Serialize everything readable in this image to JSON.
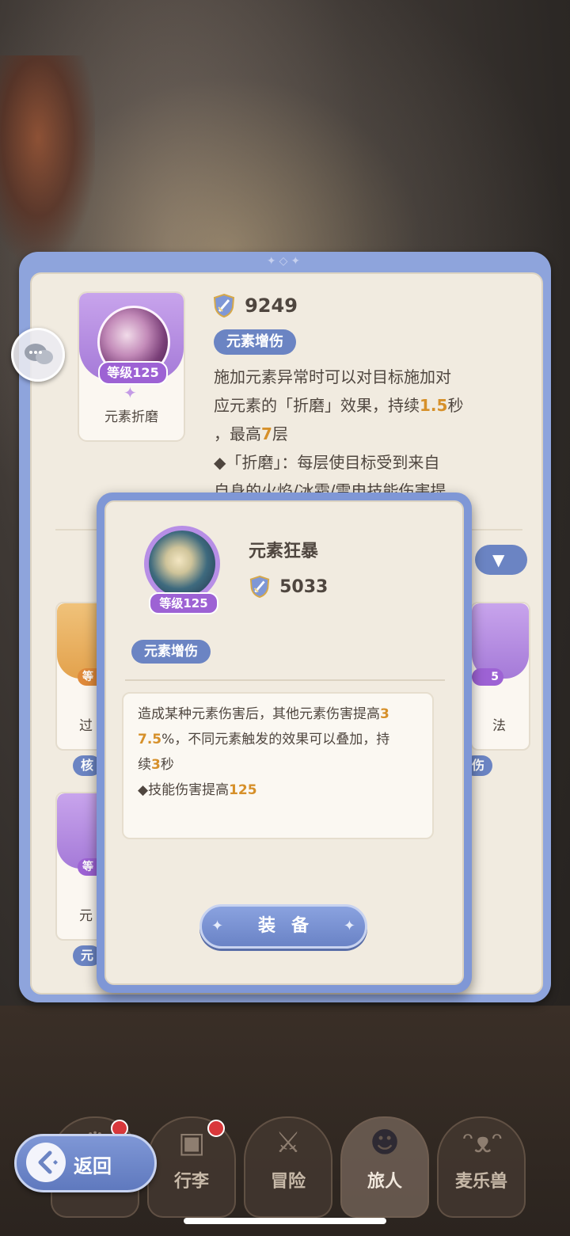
{
  "main_skill": {
    "level_badge": "等级125",
    "name": "元素折磨",
    "power": "9249",
    "tag": "元素增伤",
    "desc_line1": "施加元素异常时可以对目标施加对",
    "desc_line2_pre": "应元素的「折磨」效果，持续",
    "desc_line2_hl": "1.5",
    "desc_line2_post": "秒",
    "desc_line3_pre": "，最高",
    "desc_line3_hl": "7",
    "desc_line3_post": "层",
    "desc_line4": "◆「折磨」：每层使目标受到来自",
    "desc_line5": "自身的火焰/冰霜/雷电技能伤害提"
  },
  "partial_cards": {
    "left_top_level": "等",
    "left_top_name": "过",
    "left_top_tag": "核",
    "right_top_level": "5",
    "right_top_name": "法",
    "right_top_tag": "伤",
    "left_bottom_level": "等",
    "left_bottom_name": "元",
    "left_bottom_tag": "元"
  },
  "popup": {
    "level_badge": "等级125",
    "name": "元素狂暴",
    "power": "5033",
    "tag": "元素增伤",
    "effect_line1_pre": "造成某种元素伤害后，其他元素伤害提高",
    "effect_line1_hl": "3",
    "effect_line2_hl": "7.5",
    "effect_line2_post": "%，不同元素触发的效果可以叠加，持",
    "effect_line3_pre": "续",
    "effect_line3_hl": "3",
    "effect_line3_post": "秒",
    "effect_line4_pre": "◆技能伤害提高",
    "effect_line4_hl": "125",
    "equip_label": "装备"
  },
  "nav": {
    "back_label": "返回",
    "items": [
      {
        "label": ""
      },
      {
        "label": "行李"
      },
      {
        "label": "冒险"
      },
      {
        "label": "旅人"
      },
      {
        "label": "麦乐兽"
      }
    ]
  },
  "colors": {
    "accent_blue": "#6b84c3",
    "highlight_orange": "#d6902a",
    "level_purple": "#9d62d4"
  }
}
